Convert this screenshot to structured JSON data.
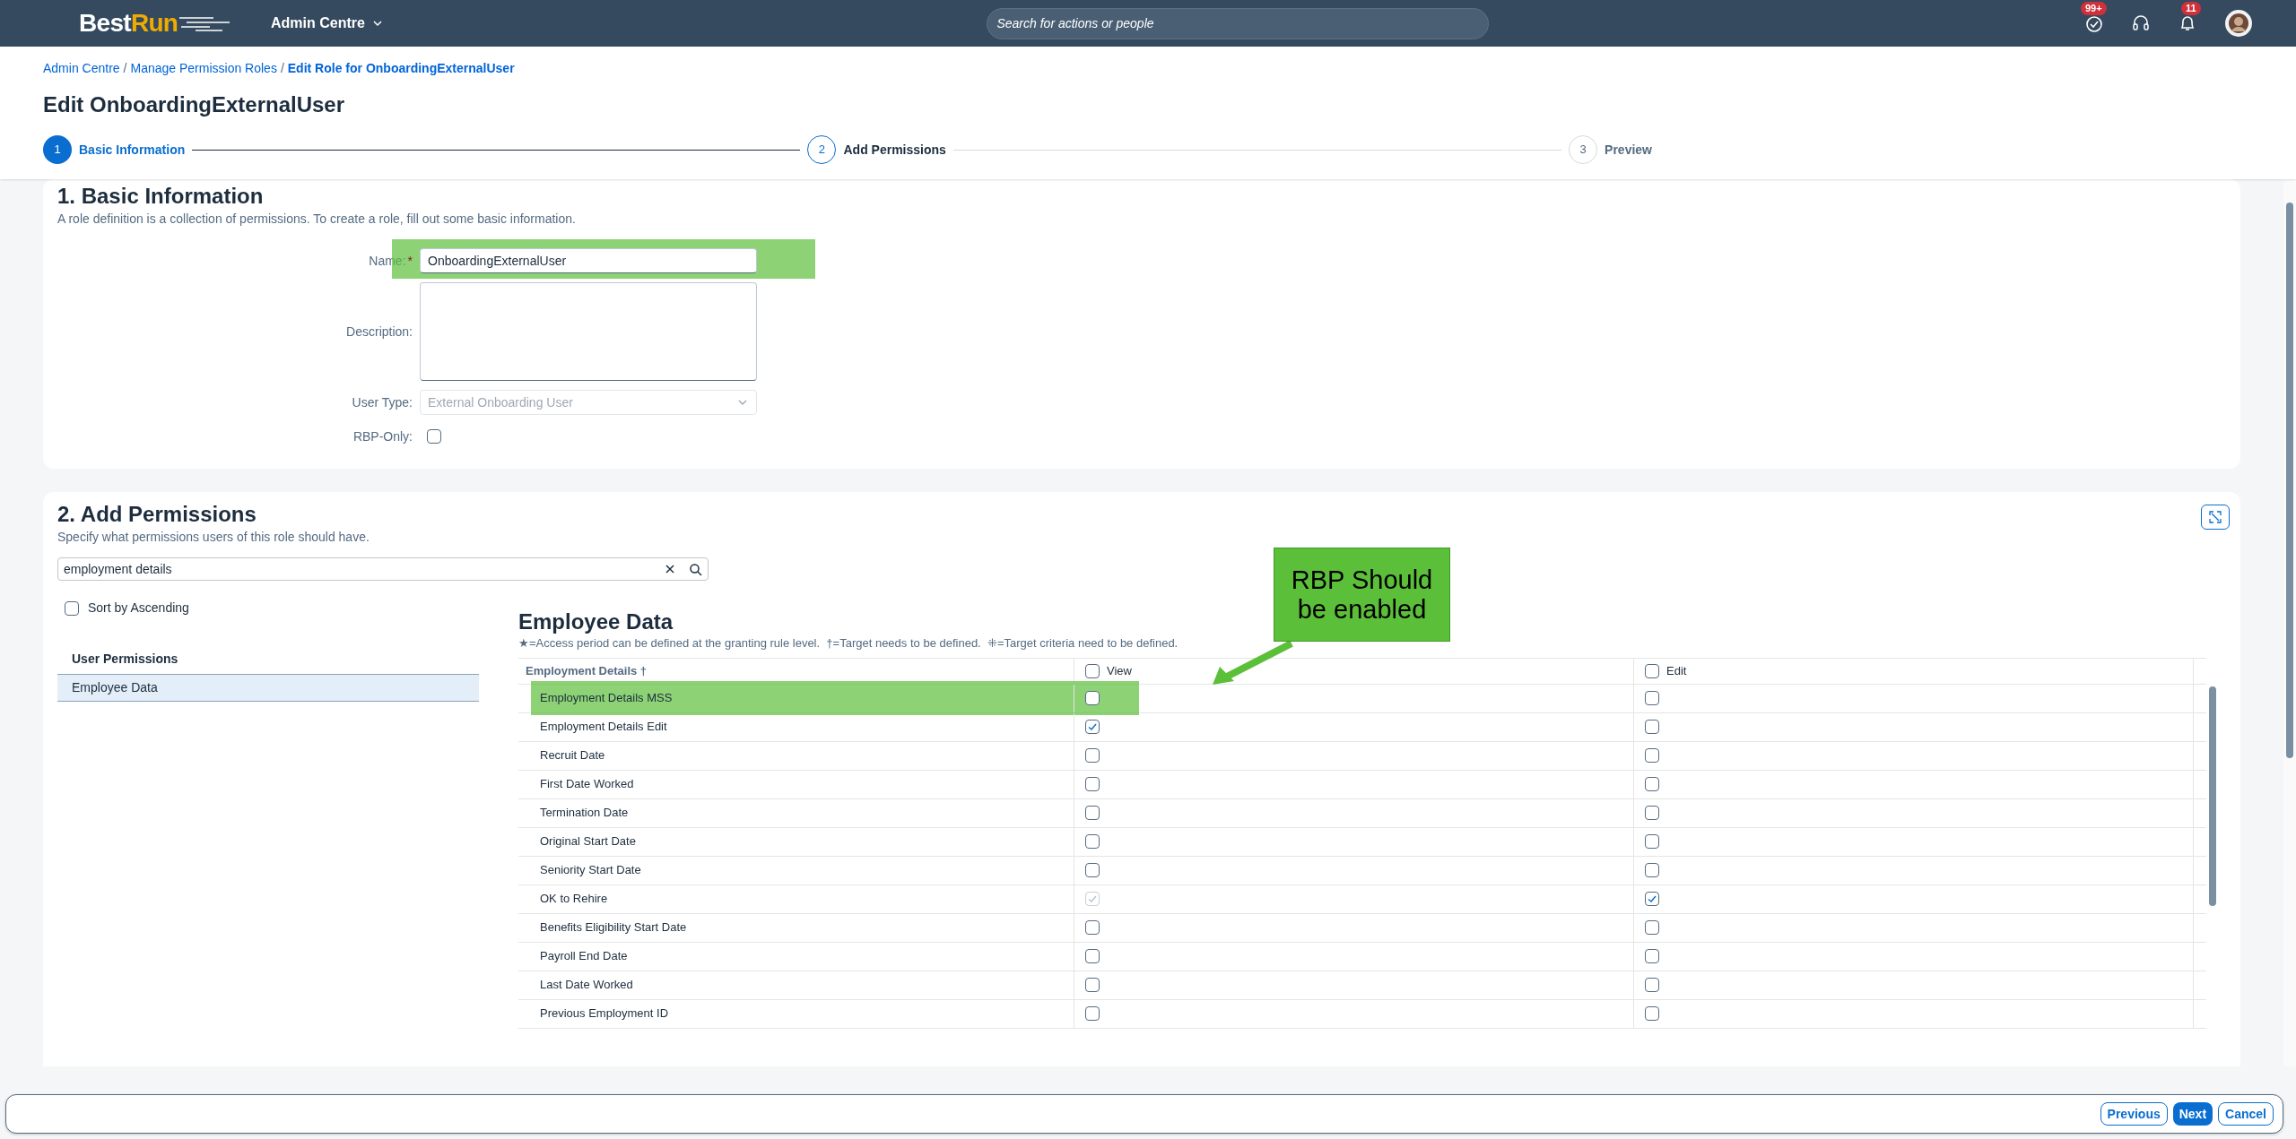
{
  "header": {
    "logo": {
      "part_1": "Best",
      "part_2": "Run"
    },
    "menu": "Admin Centre",
    "search": {
      "placeholder": "Search for actions or people"
    },
    "badges": [
      "99+",
      "11"
    ]
  },
  "breadcrumb": [
    {
      "label": "Admin Centre",
      "current": false
    },
    {
      "separator": "/",
      "label": "Manage Permission Roles",
      "current": false
    },
    {
      "separator": "/",
      "label": "Edit Role for OnboardingExternalUser",
      "current": true
    }
  ],
  "title": "Edit OnboardingExternalUser",
  "steps": [
    {
      "number": "1",
      "label": "Basic Information",
      "selected": true
    },
    {
      "number": "2",
      "label": "Add Permissions",
      "selected": false
    },
    {
      "number": "3",
      "label": "Preview",
      "selected": false
    }
  ],
  "basic_information": {
    "heading": "1. Basic Information",
    "description": "A role definition is a collection of permissions. To create a role, fill out some basic information.",
    "fields": [
      {
        "kind": "text",
        "label": "Name:",
        "required_mark": "*",
        "highlighted": true,
        "value": "OnboardingExternalUser"
      },
      {
        "kind": "textarea",
        "label": "Description:",
        "highlighted": false
      },
      {
        "kind": "select",
        "label": "User Type:",
        "highlighted": false,
        "disabled": true,
        "value": "External Onboarding User"
      },
      {
        "kind": "checkbox",
        "label": "RBP-Only:",
        "highlighted": false,
        "checked": false
      }
    ]
  },
  "add_permissions": {
    "heading": "2. Add Permissions",
    "description": "Specify what permissions users of this role should have.",
    "search": {
      "value": "employment details"
    },
    "sort": {
      "label": "Sort by Ascending",
      "checked": false
    },
    "list_heading": "User Permissions",
    "items": [
      {
        "label": "Employee Data",
        "selected": true
      }
    ],
    "panel": {
      "title": "Employee Data",
      "legend": "★=Access period can be defined at the granting rule level.  †=Target needs to be defined.  ⁜=Target criteria need to be defined.",
      "columns": [
        {
          "label": "Employment Details †"
        },
        {
          "label": "View",
          "checked": false
        },
        {
          "label": "Edit",
          "checked": false
        }
      ],
      "rows": [
        {
          "name": "Employment Details MSS",
          "highlighted": true,
          "view": {
            "checked": false,
            "disabled": false
          },
          "edit": {
            "checked": false,
            "disabled": false
          }
        },
        {
          "name": "Employment Details Edit",
          "highlighted": false,
          "view": {
            "checked": true,
            "disabled": false
          },
          "edit": {
            "checked": false,
            "disabled": false
          }
        },
        {
          "name": "Recruit Date",
          "highlighted": false,
          "view": {
            "checked": false,
            "disabled": false
          },
          "edit": {
            "checked": false,
            "disabled": false
          }
        },
        {
          "name": "First Date Worked",
          "highlighted": false,
          "view": {
            "checked": false,
            "disabled": false
          },
          "edit": {
            "checked": false,
            "disabled": false
          }
        },
        {
          "name": "Termination Date",
          "highlighted": false,
          "view": {
            "checked": false,
            "disabled": false
          },
          "edit": {
            "checked": false,
            "disabled": false
          }
        },
        {
          "name": "Original Start Date",
          "highlighted": false,
          "view": {
            "checked": false,
            "disabled": false
          },
          "edit": {
            "checked": false,
            "disabled": false
          }
        },
        {
          "name": "Seniority Start Date",
          "highlighted": false,
          "view": {
            "checked": false,
            "disabled": false
          },
          "edit": {
            "checked": false,
            "disabled": false
          }
        },
        {
          "name": "OK to Rehire",
          "highlighted": false,
          "view": {
            "checked": true,
            "disabled": true
          },
          "edit": {
            "checked": true,
            "disabled": false
          }
        },
        {
          "name": "Benefits Eligibility Start Date",
          "highlighted": false,
          "view": {
            "checked": false,
            "disabled": false
          },
          "edit": {
            "checked": false,
            "disabled": false
          }
        },
        {
          "name": "Payroll End Date",
          "highlighted": false,
          "view": {
            "checked": false,
            "disabled": false
          },
          "edit": {
            "checked": false,
            "disabled": false
          }
        },
        {
          "name": "Last Date Worked",
          "highlighted": false,
          "view": {
            "checked": false,
            "disabled": false
          },
          "edit": {
            "checked": false,
            "disabled": false
          }
        },
        {
          "name": "Previous Employment ID",
          "highlighted": false,
          "view": {
            "checked": false,
            "disabled": false
          },
          "edit": {
            "checked": false,
            "disabled": false
          }
        }
      ]
    }
  },
  "annotation": {
    "callout": "RBP Should be enabled"
  },
  "buttons": [
    {
      "label": "Previous",
      "kind": "secondary"
    },
    {
      "label": "Next",
      "kind": "primary"
    },
    {
      "label": "Cancel",
      "kind": "secondary"
    }
  ]
}
